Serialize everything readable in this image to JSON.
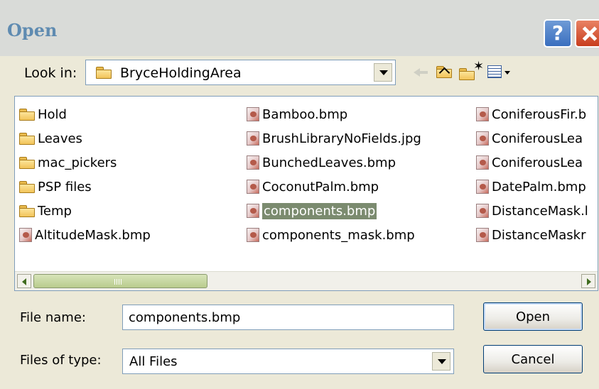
{
  "window": {
    "title": "Open",
    "help_label": "?",
    "close_label": "close"
  },
  "toolbar": {
    "look_in_label": "Look in:",
    "look_in_value": "BryceHoldingArea",
    "back_icon": "back-arrow-icon",
    "up_icon": "up-one-level-icon",
    "new_folder_icon": "new-folder-icon",
    "views_icon": "view-menu-icon"
  },
  "files": {
    "column_1": [
      {
        "name": "Hold",
        "type": "folder"
      },
      {
        "name": "Leaves",
        "type": "folder"
      },
      {
        "name": "mac_pickers",
        "type": "folder"
      },
      {
        "name": "PSP files",
        "type": "folder"
      },
      {
        "name": "Temp",
        "type": "folder"
      },
      {
        "name": "AltitudeMask.bmp",
        "type": "bmp"
      }
    ],
    "column_2": [
      {
        "name": "Bamboo.bmp",
        "type": "bmp"
      },
      {
        "name": "BrushLibraryNoFields.jpg",
        "type": "bmp"
      },
      {
        "name": "BunchedLeaves.bmp",
        "type": "bmp"
      },
      {
        "name": "CoconutPalm.bmp",
        "type": "bmp"
      },
      {
        "name": "components.bmp",
        "type": "bmp",
        "selected": true
      },
      {
        "name": "components_mask.bmp",
        "type": "bmp"
      }
    ],
    "column_3": [
      {
        "name": "ConiferousFir.b",
        "type": "bmp"
      },
      {
        "name": "ConiferousLea",
        "type": "bmp"
      },
      {
        "name": "ConiferousLea",
        "type": "bmp"
      },
      {
        "name": "DatePalm.bmp",
        "type": "bmp"
      },
      {
        "name": "DistanceMask.l",
        "type": "bmp"
      },
      {
        "name": "DistanceMaskr",
        "type": "bmp"
      }
    ]
  },
  "footer": {
    "file_name_label": "File name:",
    "file_name_value": "components.bmp",
    "file_type_label": "Files of type:",
    "file_type_value": "All Files",
    "open_label": "Open",
    "cancel_label": "Cancel"
  },
  "colors": {
    "title_text": "#5f8bb1",
    "selection": "#7b8b6f",
    "close_button": "#d9542f",
    "help_button": "#3a6fbf"
  }
}
